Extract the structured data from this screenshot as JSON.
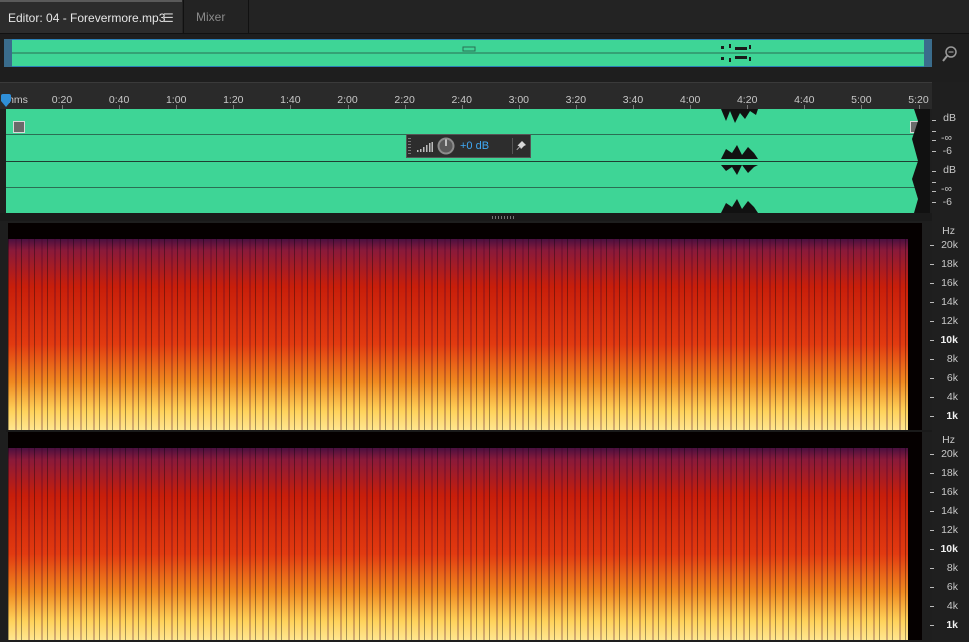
{
  "tabs": {
    "editor_label": "Editor: 04 - Forevermore.mp3",
    "mixer_label": "Mixer"
  },
  "ruler": {
    "unit": "hms",
    "ticks": [
      "0:20",
      "0:40",
      "1:00",
      "1:20",
      "1:40",
      "2:00",
      "2:20",
      "2:40",
      "3:00",
      "3:20",
      "3:40",
      "4:00",
      "4:20",
      "4:40",
      "5:00",
      "5:20"
    ]
  },
  "hud": {
    "gain_value": "+0 dB"
  },
  "amplitude_scale": {
    "unit": "dB",
    "labels": [
      "-∞",
      "-6"
    ]
  },
  "frequency_scale": {
    "unit": "Hz",
    "labels": [
      "20k",
      "18k",
      "16k",
      "14k",
      "12k",
      "10k",
      "8k",
      "6k",
      "4k",
      "1k"
    ]
  },
  "colors": {
    "waveform": "#3ed596",
    "accent": "#3fa9f5",
    "spectro_hot": "#ffd25a",
    "spectro_mid": "#c81e0a",
    "spectro_low": "#6a1446"
  },
  "icons": {
    "tab_menu": "hamburger-icon",
    "zoom": "zoom-icon",
    "headphones": "headphones-icon",
    "pin": "pin-icon"
  }
}
